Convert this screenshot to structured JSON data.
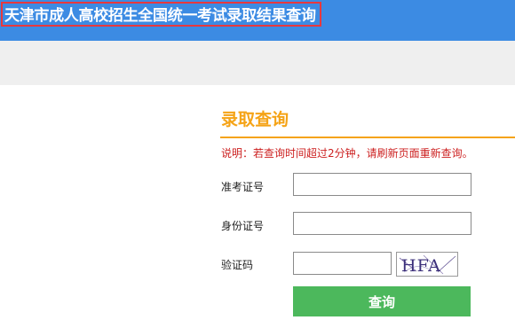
{
  "header": {
    "site_title": "天津市成人高校招生全国统一考试录取结果查询"
  },
  "colors": {
    "banner": "#3c8be3",
    "title_highlight_border": "#e8383d",
    "accent_orange": "#f5a316",
    "notice_red": "#cc1f1f",
    "button_green": "#4cb85c"
  },
  "query_form": {
    "title": "录取查询",
    "notice": "说明：若查询时间超过2分钟，请刷新页面重新查询。",
    "exam_number_label": "准考证号",
    "exam_number_value": "",
    "id_number_label": "身份证号",
    "id_number_value": "",
    "captcha_label": "验证码",
    "captcha_value": "",
    "captcha_text": "HFA",
    "submit_label": "查询"
  }
}
